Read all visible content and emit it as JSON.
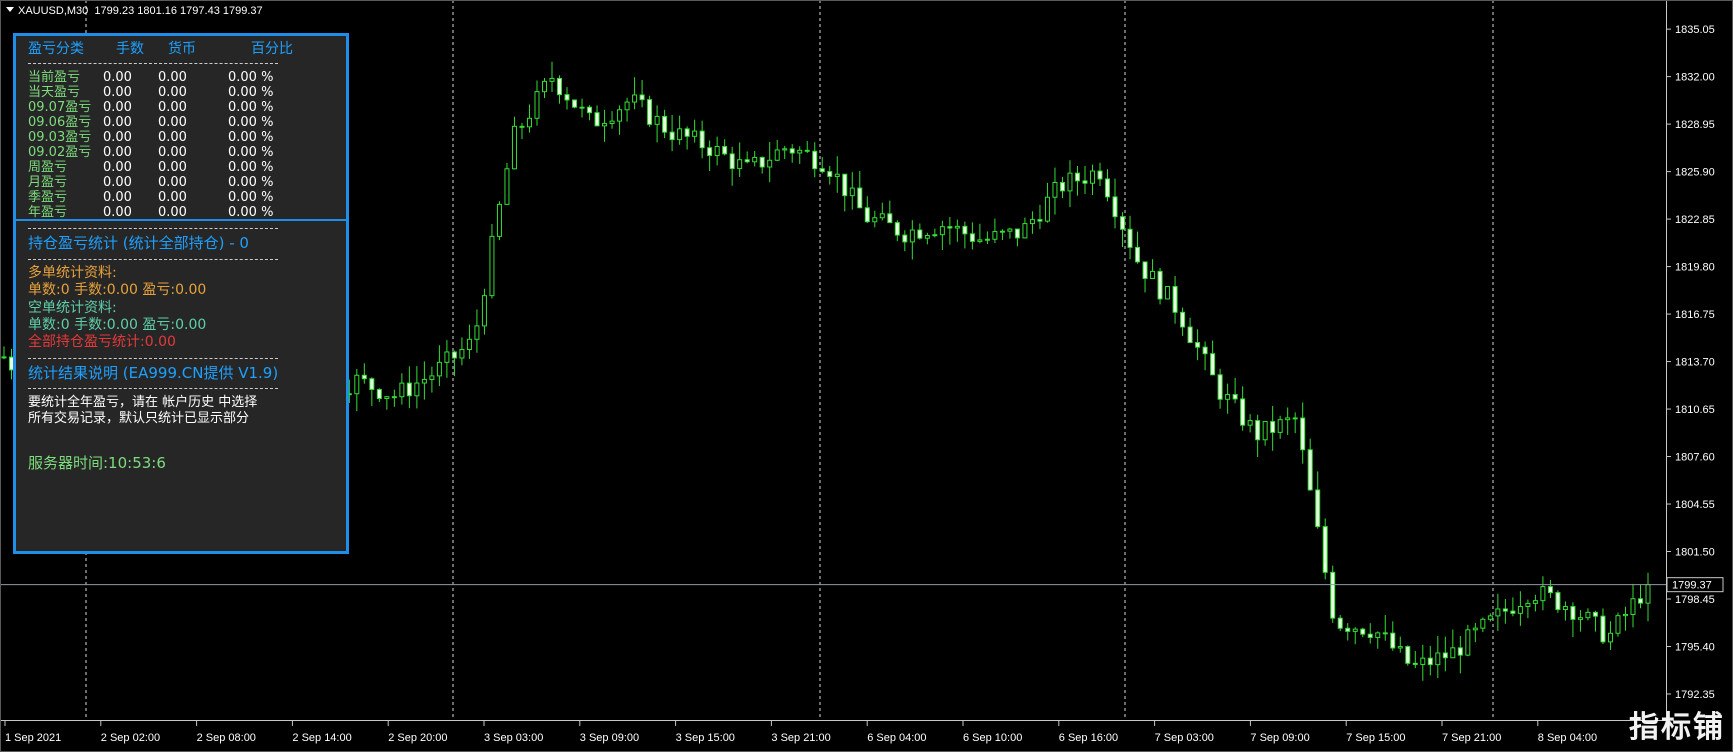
{
  "header": {
    "symbol": "XAUUSD,M30",
    "ohlc": "1799.23 1801.16 1797.43 1799.37"
  },
  "panel": {
    "col_headers": [
      "盈亏分类",
      "手数",
      "货币",
      "百分比"
    ],
    "rows": [
      {
        "label": "当前盈亏",
        "lots": "0.00",
        "money": "0.00",
        "pct": "0.00 %"
      },
      {
        "label": "当天盈亏",
        "lots": "0.00",
        "money": "0.00",
        "pct": "0.00 %"
      },
      {
        "label": "09.07盈亏",
        "lots": "0.00",
        "money": "0.00",
        "pct": "0.00 %"
      },
      {
        "label": "09.06盈亏",
        "lots": "0.00",
        "money": "0.00",
        "pct": "0.00 %"
      },
      {
        "label": "09.03盈亏",
        "lots": "0.00",
        "money": "0.00",
        "pct": "0.00 %"
      },
      {
        "label": "09.02盈亏",
        "lots": "0.00",
        "money": "0.00",
        "pct": "0.00 %"
      },
      {
        "label": "周盈亏",
        "lots": "0.00",
        "money": "0.00",
        "pct": "0.00 %"
      },
      {
        "label": "月盈亏",
        "lots": "0.00",
        "money": "0.00",
        "pct": "0.00 %"
      },
      {
        "label": "季盈亏",
        "lots": "0.00",
        "money": "0.00",
        "pct": "0.00 %"
      },
      {
        "label": "年盈亏",
        "lots": "0.00",
        "money": "0.00",
        "pct": "0.00 %"
      }
    ],
    "position_title": "持仓盈亏统计  (统计全部持仓) - 0",
    "long_title": "多单统计资料:",
    "long_detail": "单数:0   手数:0.00 盈亏:0.00",
    "short_title": "空单统计资料:",
    "short_detail": "单数:0   手数:0.00 盈亏:0.00",
    "total": "全部持仓盈亏统计:0.00",
    "result_title": "统计结果说明  (EA999.CN提供 V1.9)",
    "desc_line1": "要统计全年盈亏，请在 帐户历史 中选择",
    "desc_line2": "所有交易记录，默认只统计已显示部分",
    "server_time": "服务器时间:10:53:6"
  },
  "watermark": "指标铺",
  "chart_data": {
    "type": "candlestick",
    "symbol": "XAUUSD",
    "timeframe": "M30",
    "ylim": [
      1791.0,
      1836.6
    ],
    "y_ticks": [
      "1835.05",
      "1832.00",
      "1828.95",
      "1825.90",
      "1822.85",
      "1819.80",
      "1816.75",
      "1813.70",
      "1810.65",
      "1807.60",
      "1804.55",
      "1801.50",
      "1798.45",
      "1795.40",
      "1792.35"
    ],
    "current_price": "1799.37",
    "x_labels": [
      "1 Sep 2021",
      "2 Sep 02:00",
      "2 Sep 08:00",
      "2 Sep 14:00",
      "2 Sep 20:00",
      "3 Sep 03:00",
      "3 Sep 09:00",
      "3 Sep 15:00",
      "3 Sep 21:00",
      "6 Sep 04:00",
      "6 Sep 10:00",
      "6 Sep 16:00",
      "7 Sep 03:00",
      "7 Sep 09:00",
      "7 Sep 15:00",
      "7 Sep 21:00",
      "8 Sep 04:00"
    ],
    "day_separators": [
      "2 Sep",
      "3 Sep",
      "6 Sep",
      "7 Sep",
      "8 Sep"
    ],
    "close_path": [
      1814.0,
      1811.5,
      1808.5,
      1810.0,
      1809.2,
      1809.8,
      1810.0,
      1813.5,
      1811.5,
      1812.5,
      1811.5,
      1813.0,
      1815.0,
      1828.0,
      1832.0,
      1829.0,
      1830.5,
      1828.5,
      1827.5,
      1826.0,
      1827.5,
      1826.5,
      1823.0,
      1822.0,
      1822.5,
      1821.5,
      1822.0,
      1825.0,
      1826.0,
      1820.0,
      1817.0,
      1812.0,
      1809.0,
      1810.0,
      1797.0,
      1796.5,
      1794.0,
      1795.0,
      1797.0,
      1799.0,
      1798.0,
      1796.0,
      1799.4
    ]
  }
}
